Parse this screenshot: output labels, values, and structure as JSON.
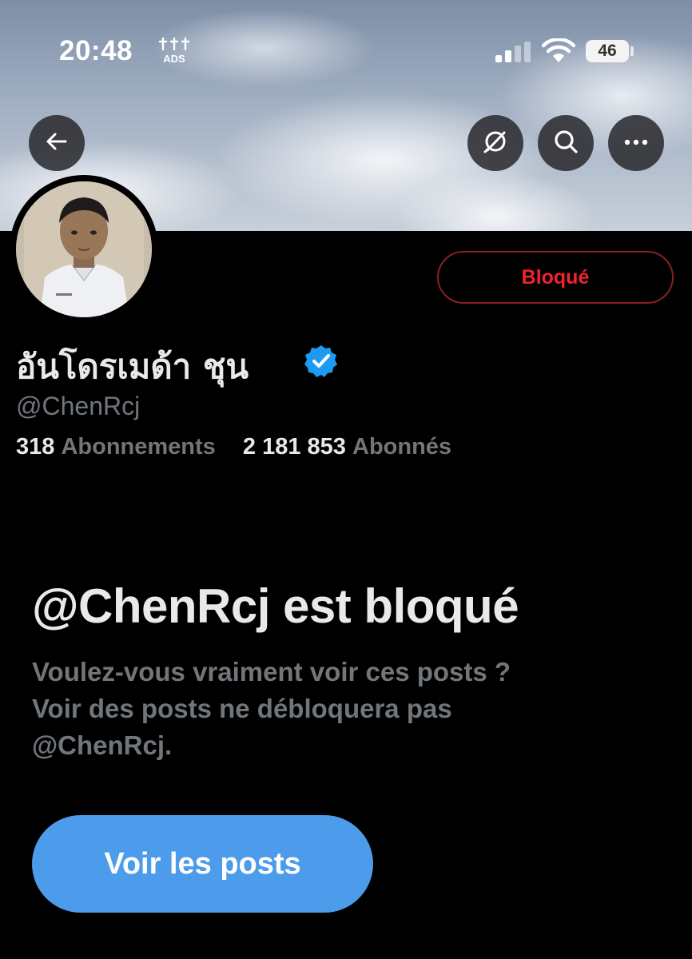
{
  "status_bar": {
    "time": "20:48",
    "battery": "46"
  },
  "profile": {
    "display_name": "อันโดรเมด้า ชุน",
    "handle": "@ChenRcj",
    "following_count": "318",
    "following_label": "Abonnements",
    "followers_count": "2 181 853",
    "followers_label": "Abonnés",
    "blocked_button_label": "Bloqué",
    "verified": true
  },
  "blocked_notice": {
    "title": "@ChenRcj est bloqué",
    "description_lines": [
      "Voulez-vous vraiment voir ces posts ?",
      "Voir des posts ne débloquera pas",
      "@ChenRcj."
    ],
    "view_posts_label": "Voir les posts"
  },
  "colors": {
    "background": "#000000",
    "accent_blue": "#4c9ceb",
    "blocked_red": "#f4212e",
    "muted_text": "#71767b",
    "primary_text": "#e7e9ea"
  },
  "icons": [
    "back-arrow-icon",
    "grok-icon",
    "search-icon",
    "more-icon",
    "verified-badge-icon",
    "cellular-signal-icon",
    "wifi-icon",
    "battery-icon"
  ]
}
